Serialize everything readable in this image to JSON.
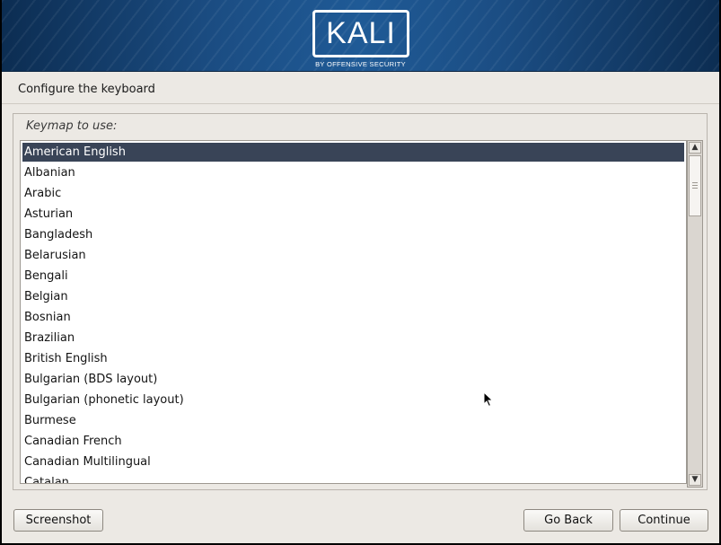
{
  "banner": {
    "logo_text": "KALI",
    "logo_tagline": "BY OFFENSIVE SECURITY"
  },
  "page": {
    "title": "Configure the keyboard"
  },
  "keymap": {
    "label": "Keymap to use:",
    "selected": "American English",
    "options": [
      "American English",
      "Albanian",
      "Arabic",
      "Asturian",
      "Bangladesh",
      "Belarusian",
      "Bengali",
      "Belgian",
      "Bosnian",
      "Brazilian",
      "British English",
      "Bulgarian (BDS layout)",
      "Bulgarian (phonetic layout)",
      "Burmese",
      "Canadian French",
      "Canadian Multilingual",
      "Catalan"
    ]
  },
  "buttons": {
    "screenshot": "Screenshot",
    "go_back": "Go Back",
    "continue": "Continue"
  },
  "icons": {
    "scroll_up": "chevron-up-icon",
    "scroll_down": "chevron-down-icon",
    "pointer": "mouse-pointer-icon"
  },
  "colors": {
    "selection": "#394457",
    "banner": "#1f5a96",
    "background": "#ece9e4"
  }
}
